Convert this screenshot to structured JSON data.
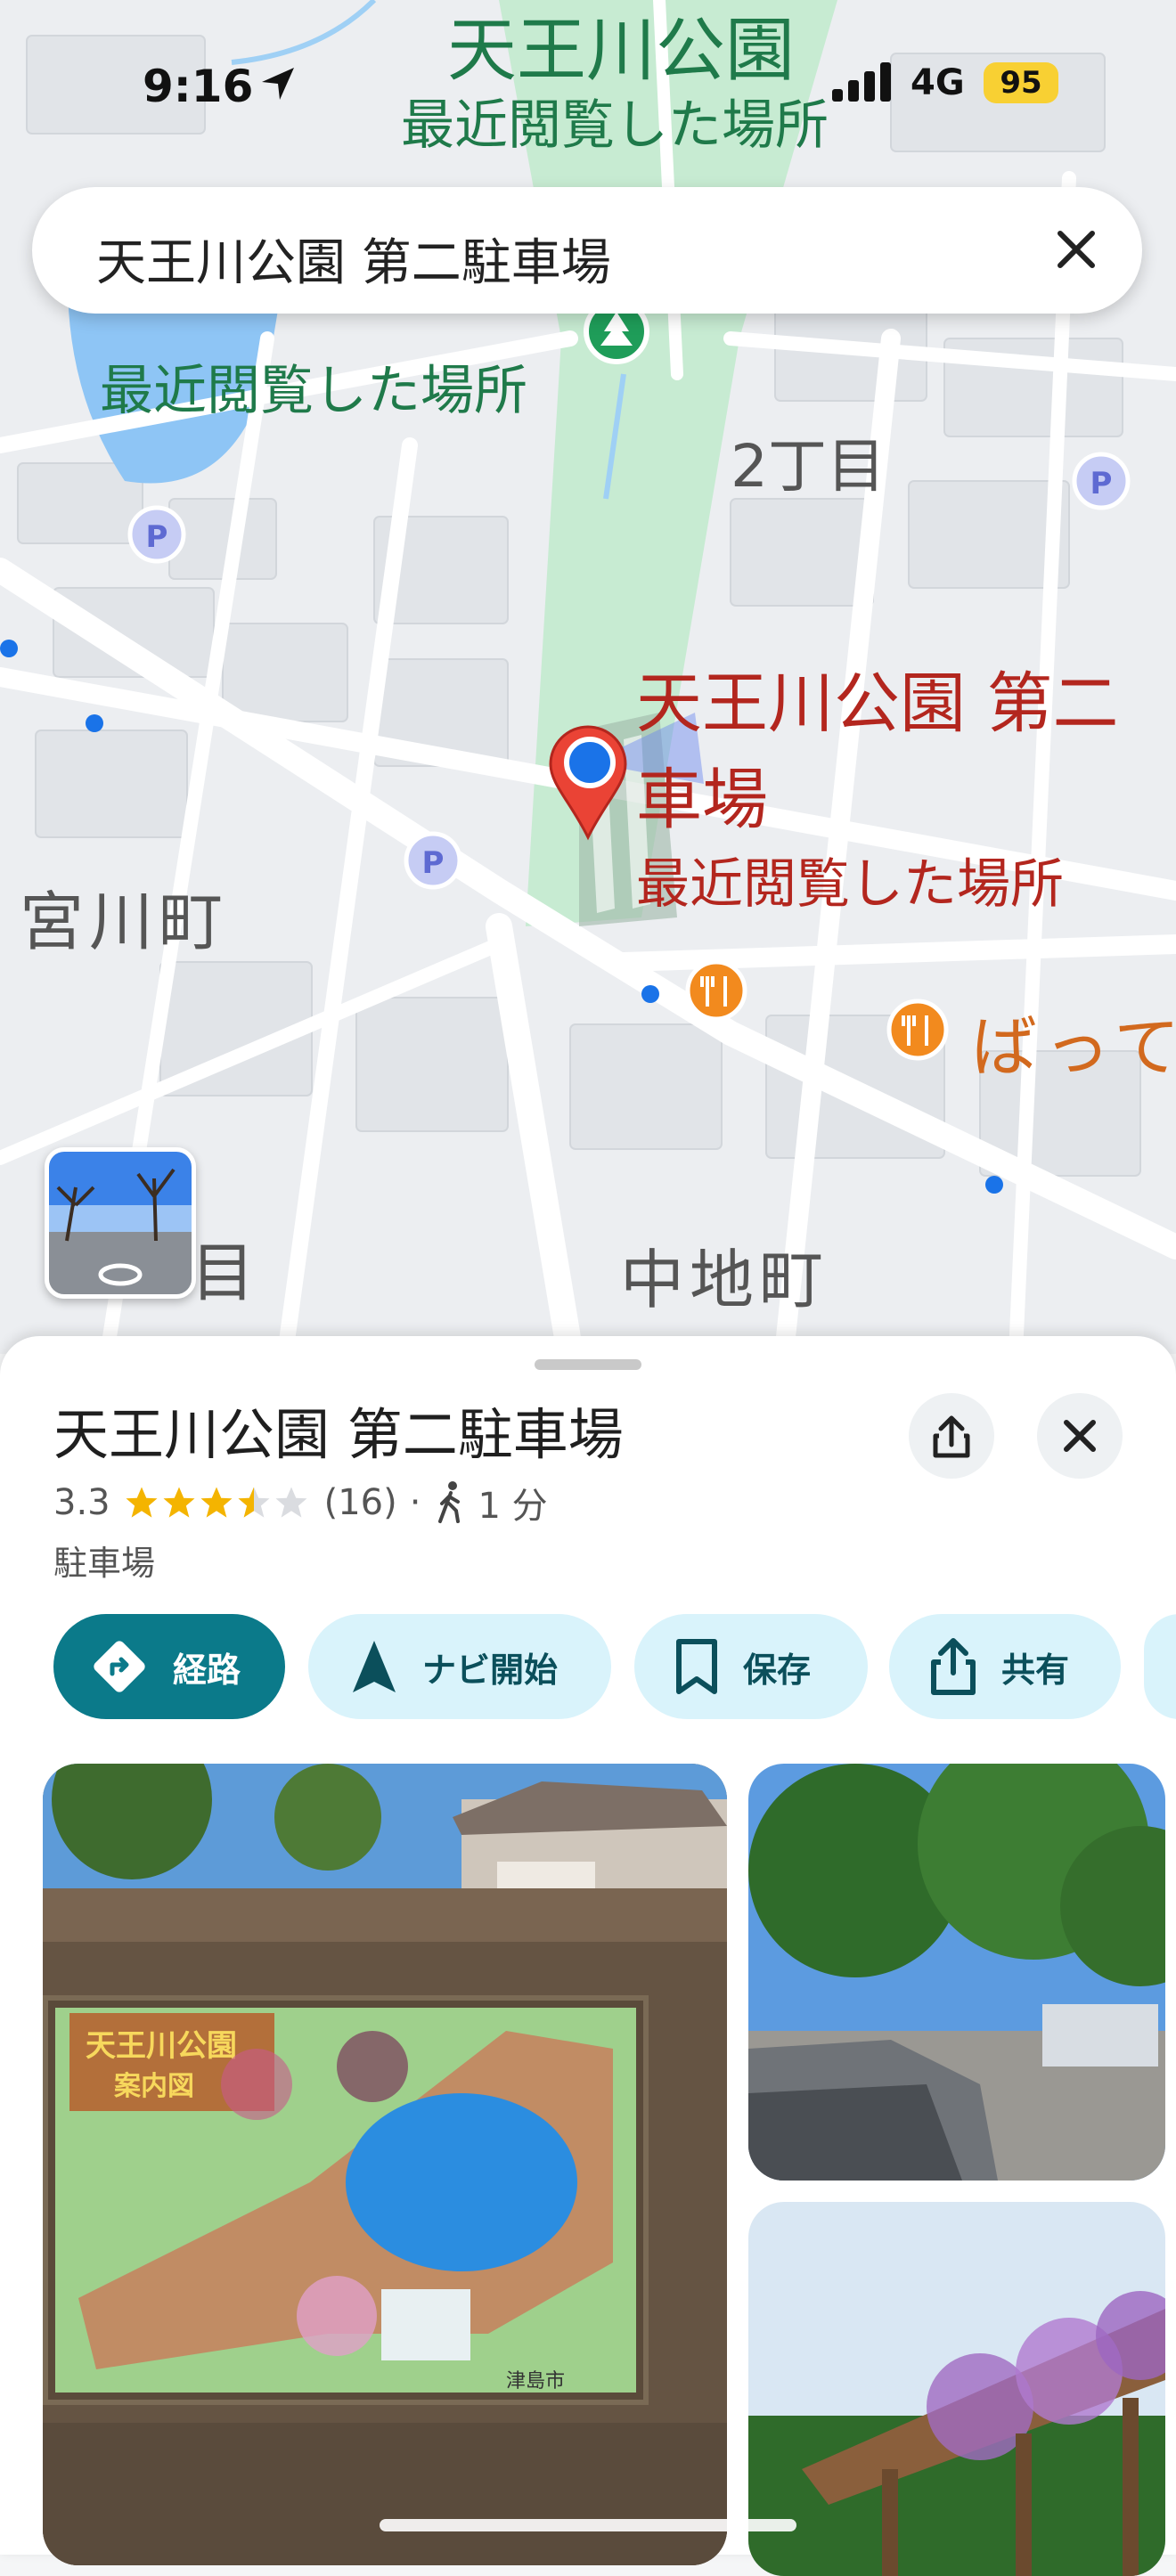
{
  "status_bar": {
    "time": "9:16",
    "network": "4G",
    "battery": "95"
  },
  "search": {
    "query": "天王川公園 第二駐車場"
  },
  "map": {
    "labels": {
      "park_top": "天王川公園",
      "recent_top": "最近閲覧した場所",
      "recent_2": "最近閲覧した場所",
      "district_2": "2丁目",
      "place_title_line1": "天王川公園 第二",
      "place_title_line2": "車場",
      "place_recent": "最近閲覧した場所",
      "miyagawa": "宮川町",
      "nakachi": "中地町",
      "restaurant": "ばって",
      "partial_label": "目"
    }
  },
  "place": {
    "name": "天王川公園 第二駐車場",
    "rating": "3.3",
    "rating_value": 3.3,
    "reviews": "(16)",
    "separator": "·",
    "walk_time": "1 分",
    "category": "駐車場"
  },
  "actions": [
    {
      "label": "経路",
      "icon": "directions-icon"
    },
    {
      "label": "ナビ開始",
      "icon": "navigation-arrow-icon"
    },
    {
      "label": "保存",
      "icon": "bookmark-icon"
    },
    {
      "label": "共有",
      "icon": "share-icon"
    }
  ],
  "photos": {
    "sign_title": "天王川公園",
    "sign_subtitle": "案内図",
    "sign_city": "津島市"
  },
  "colors": {
    "primary_teal": "#0b7a8a",
    "chip_bg": "#d9f3fb",
    "park_green": "#c7ebd2",
    "label_red": "#b3261e",
    "label_green": "#1f7a4a",
    "restaurant_orange": "#d2691e",
    "parking_purple": "#5e6ad2",
    "star_gold": "#f4b400"
  }
}
